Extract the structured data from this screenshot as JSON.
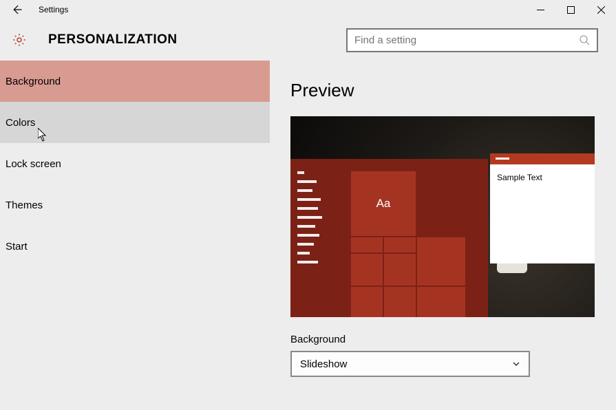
{
  "window": {
    "title": "Settings"
  },
  "header": {
    "page_title": "PERSONALIZATION"
  },
  "search": {
    "placeholder": "Find a setting"
  },
  "sidebar": {
    "items": [
      {
        "label": "Background",
        "state": "selected"
      },
      {
        "label": "Colors",
        "state": "hover"
      },
      {
        "label": "Lock screen",
        "state": ""
      },
      {
        "label": "Themes",
        "state": ""
      },
      {
        "label": "Start",
        "state": ""
      }
    ]
  },
  "content": {
    "preview_heading": "Preview",
    "tile_text": "Aa",
    "sample_window_text": "Sample Text",
    "background_label": "Background",
    "background_value": "Slideshow"
  },
  "colors": {
    "accent": "#a43421",
    "accent_dark": "#7c2116",
    "selected_nav": "#d89b91"
  }
}
